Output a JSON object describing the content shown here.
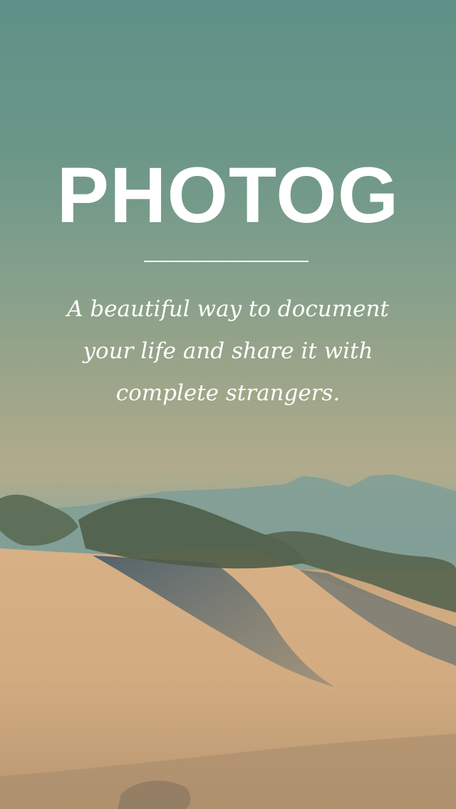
{
  "app": {
    "title": "PHOTOG",
    "tagline": "A beautiful way to document your life and share it with complete strangers."
  },
  "colors": {
    "text": "#ffffff",
    "sky_top": "#5f9188",
    "sky_mid": "#a2a68a",
    "sand": "#d4ad82",
    "mountain": "#7f9e97",
    "shadow": "#3e5a68",
    "grass": "#52614c"
  },
  "background": {
    "scene": "desert-dunes-photo"
  }
}
